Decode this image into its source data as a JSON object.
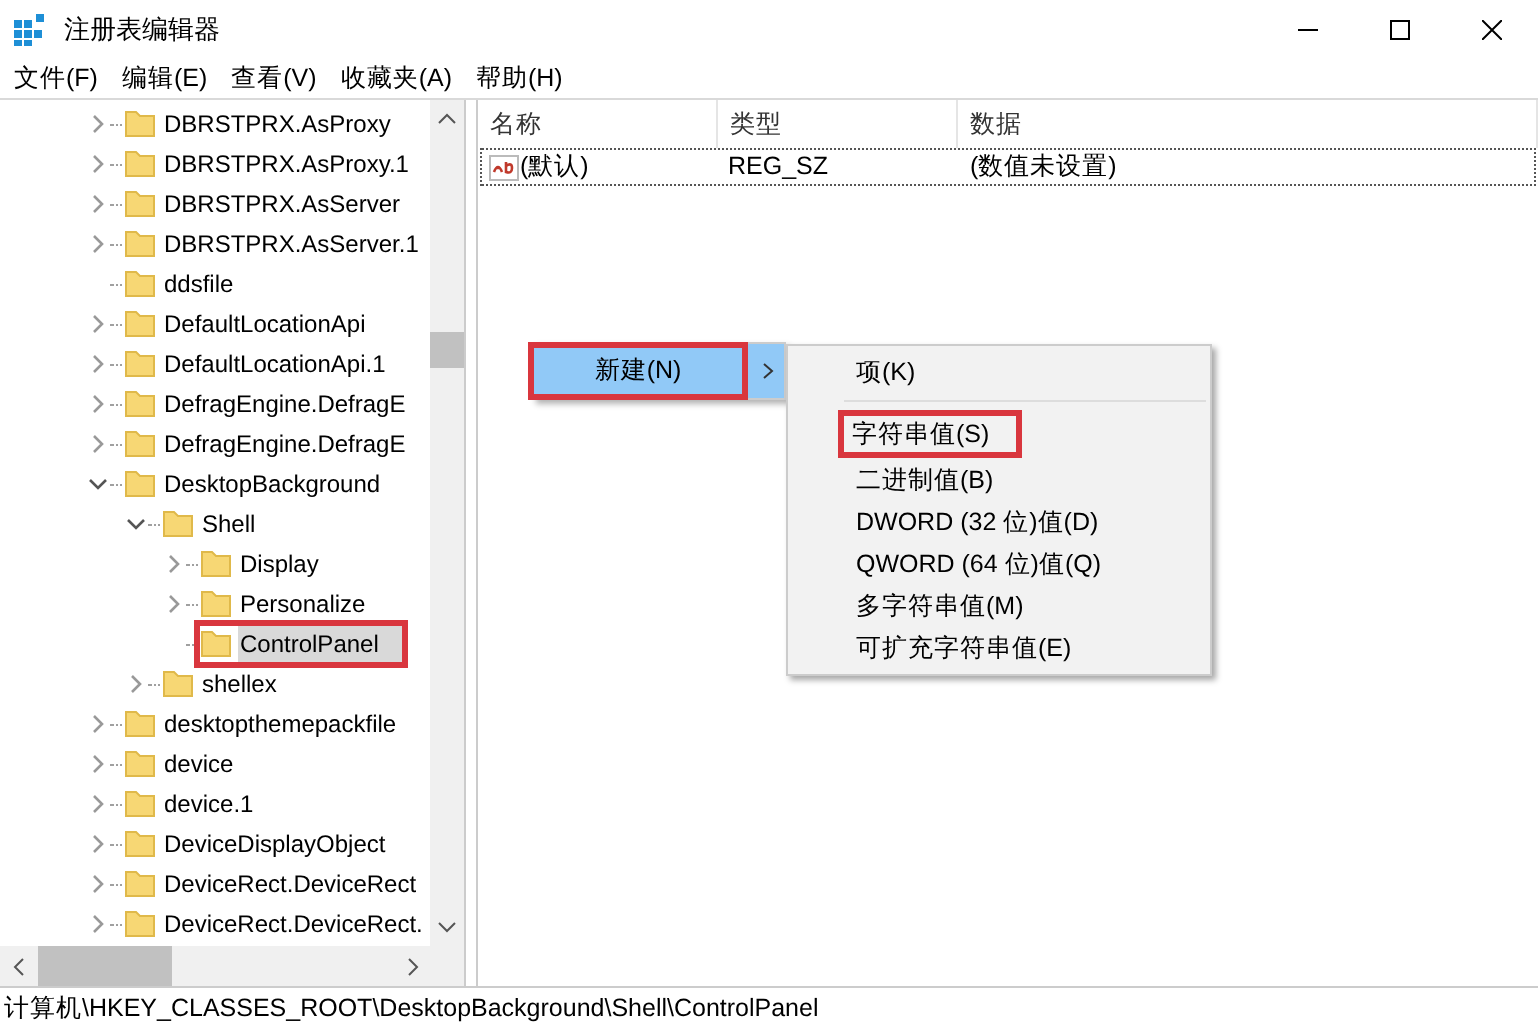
{
  "window": {
    "title": "注册表编辑器"
  },
  "menu": [
    {
      "label": "文件(F)"
    },
    {
      "label": "编辑(E)"
    },
    {
      "label": "查看(V)"
    },
    {
      "label": "收藏夹(A)"
    },
    {
      "label": "帮助(H)"
    }
  ],
  "tree": {
    "items": [
      {
        "label": "DBRSTPRX.AsProxy",
        "expandable": true,
        "expanded": false,
        "selected": false,
        "highlighted": false
      },
      {
        "label": "DBRSTPRX.AsProxy.1",
        "expandable": true,
        "expanded": false,
        "selected": false,
        "highlighted": false
      },
      {
        "label": "DBRSTPRX.AsServer",
        "expandable": true,
        "expanded": false,
        "selected": false,
        "highlighted": false
      },
      {
        "label": "DBRSTPRX.AsServer.1",
        "expandable": true,
        "expanded": false,
        "selected": false,
        "highlighted": false
      },
      {
        "label": "ddsfile",
        "expandable": false,
        "selected": false,
        "highlighted": false
      },
      {
        "label": "DefaultLocationApi",
        "expandable": true,
        "expanded": false,
        "selected": false,
        "highlighted": false
      },
      {
        "label": "DefaultLocationApi.1",
        "expandable": true,
        "expanded": false,
        "selected": false,
        "highlighted": false
      },
      {
        "label": "DefragEngine.DefragE",
        "expandable": true,
        "expanded": false,
        "selected": false,
        "highlighted": false
      },
      {
        "label": "DefragEngine.DefragE",
        "expandable": true,
        "expanded": false,
        "selected": false,
        "highlighted": false
      },
      {
        "label": "DesktopBackground",
        "expandable": true,
        "expanded": true,
        "selected": false,
        "highlighted": false,
        "children": [
          {
            "label": "Shell",
            "expandable": true,
            "expanded": true,
            "selected": false,
            "highlighted": false,
            "children": [
              {
                "label": "Display",
                "expandable": true,
                "expanded": false,
                "selected": false,
                "highlighted": false
              },
              {
                "label": "Personalize",
                "expandable": true,
                "expanded": false,
                "selected": false,
                "highlighted": false
              },
              {
                "label": "ControlPanel",
                "expandable": false,
                "selected": true,
                "highlighted": true
              }
            ]
          },
          {
            "label": "shellex",
            "expandable": true,
            "expanded": false,
            "selected": false,
            "highlighted": false
          }
        ]
      },
      {
        "label": "desktopthemepackfile",
        "expandable": true,
        "expanded": false,
        "selected": false,
        "highlighted": false
      },
      {
        "label": "device",
        "expandable": true,
        "expanded": false,
        "selected": false,
        "highlighted": false
      },
      {
        "label": "device.1",
        "expandable": true,
        "expanded": false,
        "selected": false,
        "highlighted": false
      },
      {
        "label": "DeviceDisplayObject",
        "expandable": true,
        "expanded": false,
        "selected": false,
        "highlighted": false
      },
      {
        "label": "DeviceRect.DeviceRect",
        "expandable": true,
        "expanded": false,
        "selected": false,
        "highlighted": false
      },
      {
        "label": "DeviceRect.DeviceRect.",
        "expandable": true,
        "expanded": false,
        "selected": false,
        "highlighted": false
      }
    ]
  },
  "list": {
    "columns": [
      "名称",
      "类型",
      "数据"
    ],
    "rows": [
      {
        "name": "(默认)",
        "type": "REG_SZ",
        "data": "(数值未设置)",
        "focused": true
      }
    ]
  },
  "context_menu": {
    "items": [
      {
        "label": "新建(N)",
        "selected": true,
        "highlighted": true
      }
    ]
  },
  "submenu": {
    "items": [
      {
        "kind": "item",
        "label": "项(K)",
        "highlighted": false
      },
      {
        "kind": "separator"
      },
      {
        "kind": "item",
        "label": "字符串值(S)",
        "highlighted": true
      },
      {
        "kind": "item",
        "label": "二进制值(B)",
        "highlighted": false
      },
      {
        "kind": "item",
        "label": "DWORD (32 位)值(D)",
        "highlighted": false
      },
      {
        "kind": "item",
        "label": "QWORD (64 位)值(Q)",
        "highlighted": false
      },
      {
        "kind": "item",
        "label": "多字符串值(M)",
        "highlighted": false
      },
      {
        "kind": "item",
        "label": "可扩充字符串值(E)",
        "highlighted": false
      }
    ]
  },
  "status_bar": {
    "path": "计算机\\HKEY_CLASSES_ROOT\\DesktopBackground\\Shell\\ControlPanel"
  }
}
